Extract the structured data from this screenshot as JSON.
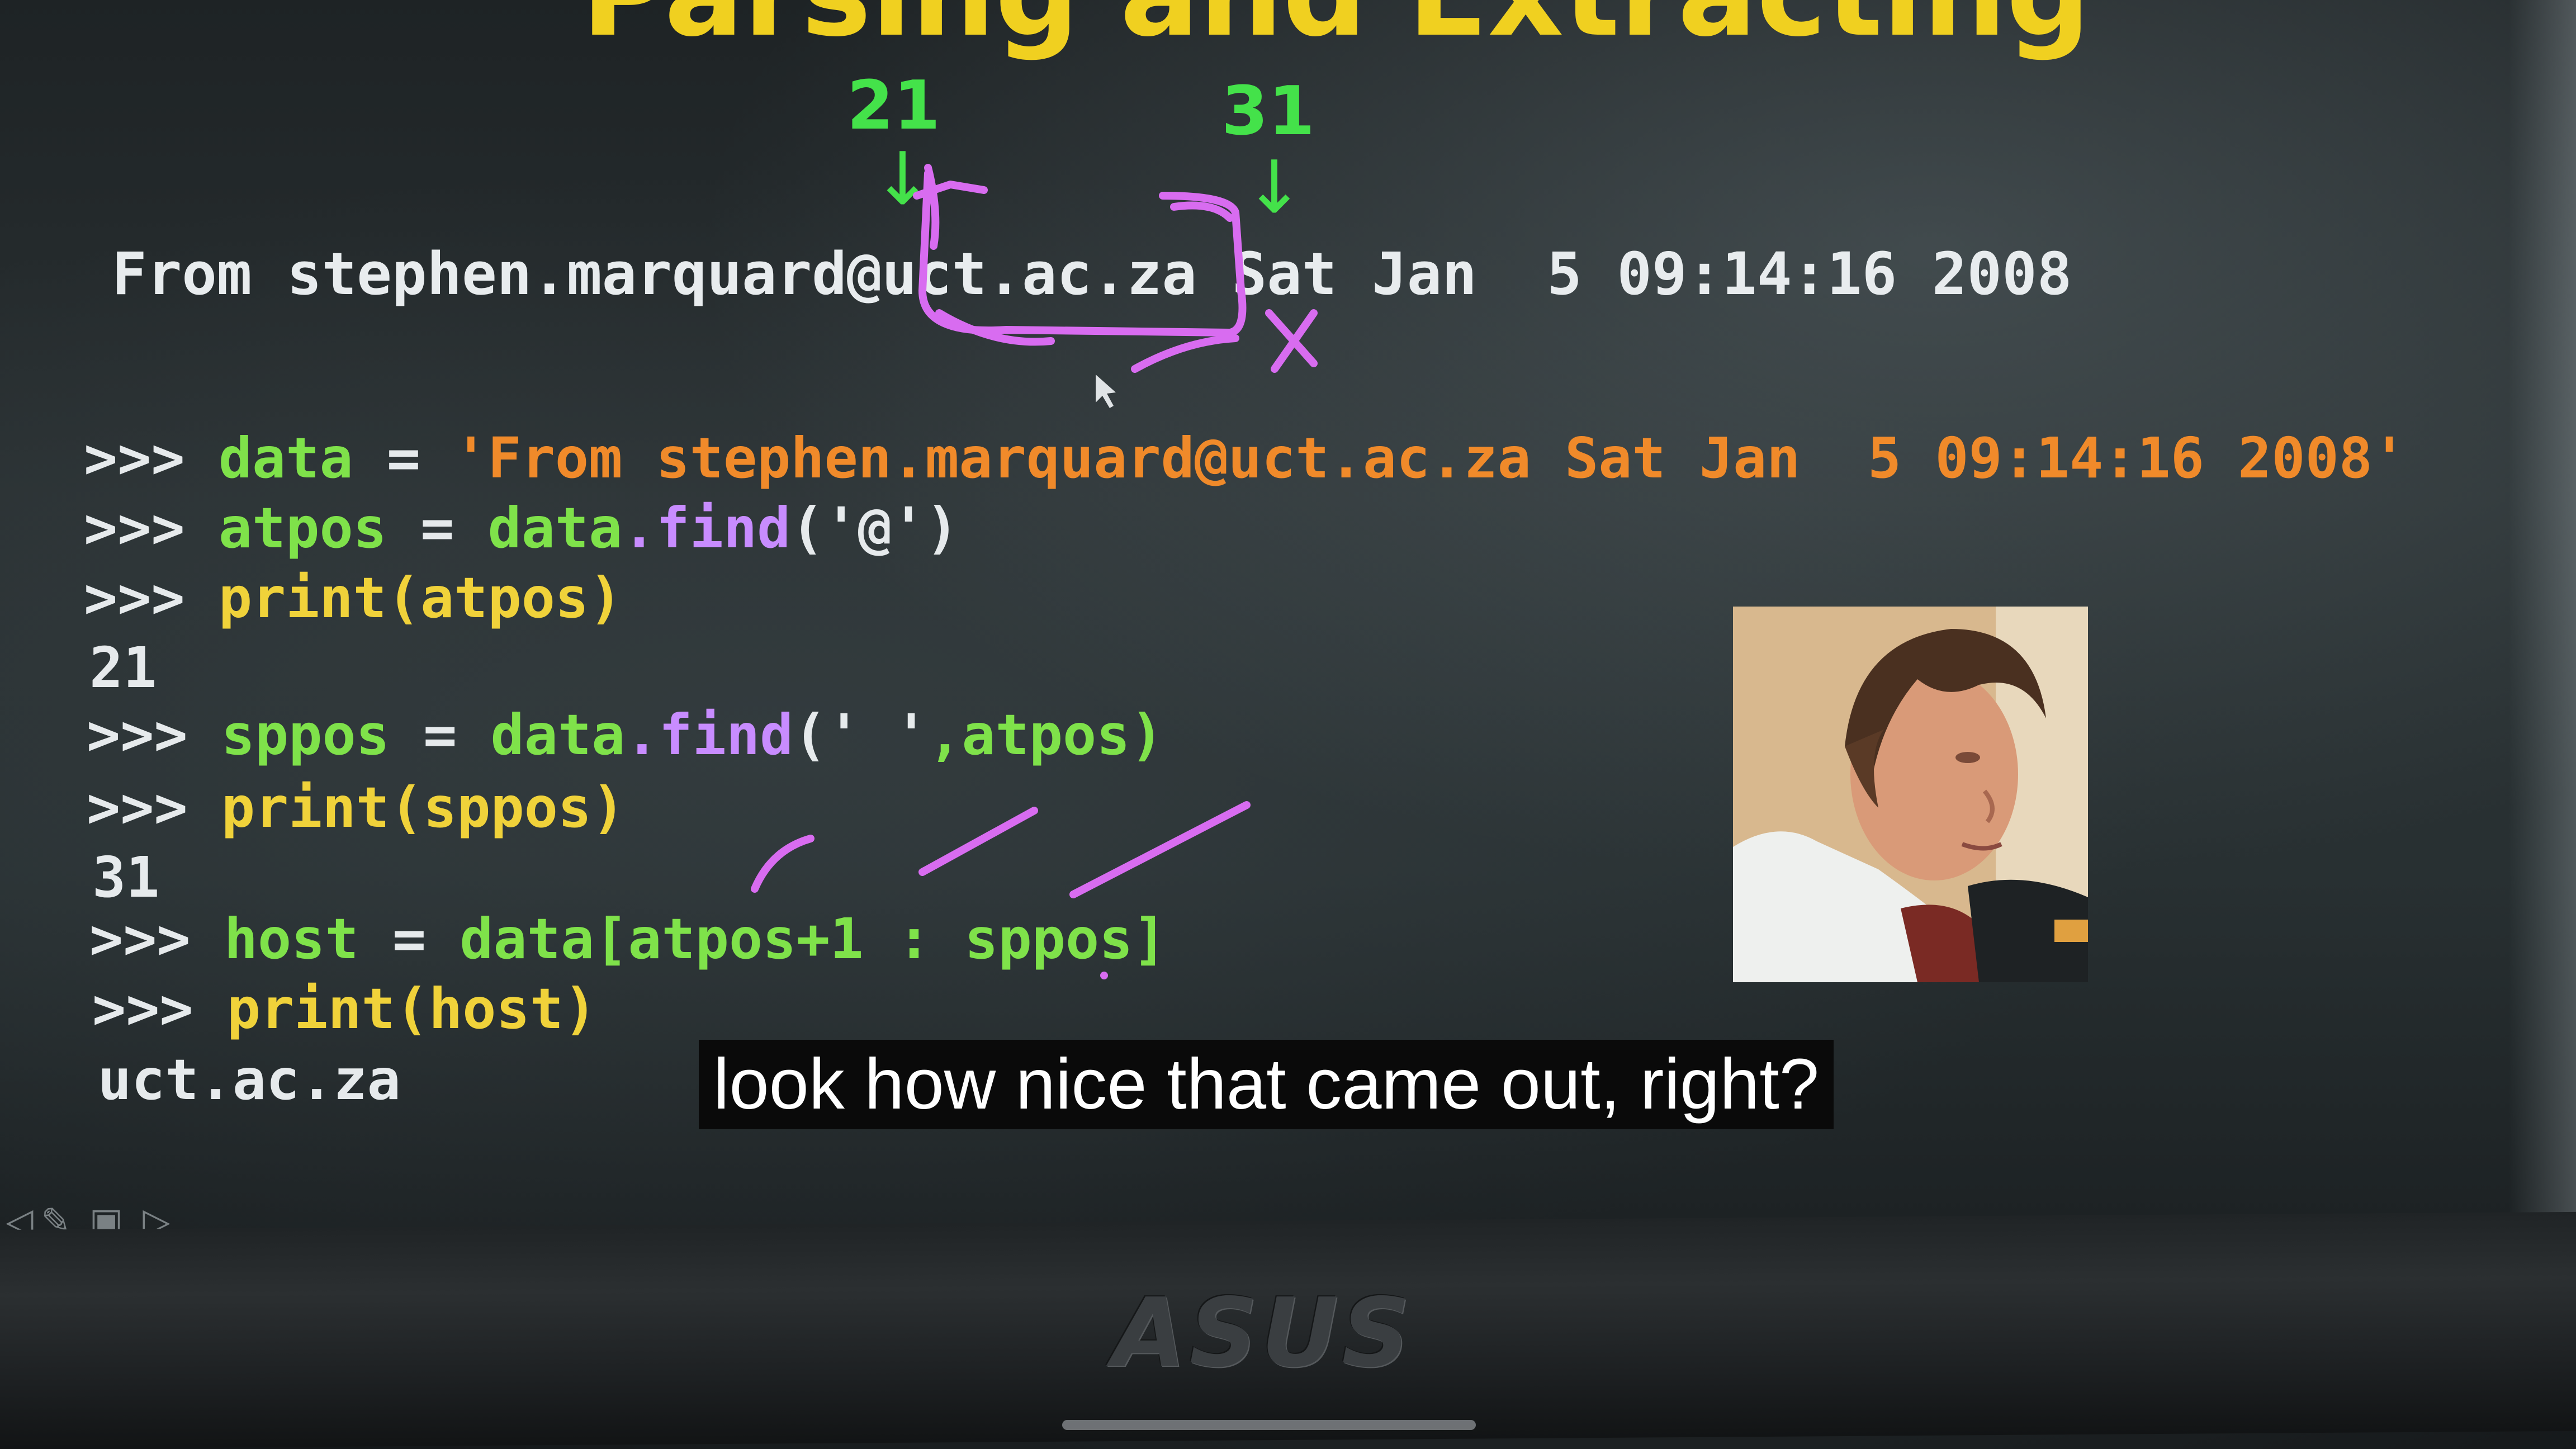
{
  "slide": {
    "title_partial": "Parsing and Extracting",
    "markers": {
      "at_index": "21",
      "space_index": "31"
    },
    "header_line": "From stephen.marquard@uct.ac.za Sat Jan  5 09:14:16 2008",
    "code": {
      "prompt": ">>>",
      "line1": {
        "var": "data",
        "eq": " = ",
        "string": "'From stephen.marquard@uct.ac.za Sat Jan  5 09:14:16 2008'"
      },
      "line2": {
        "var": "atpos",
        "eq": " = ",
        "obj": "data",
        "dot": ".",
        "method": "find",
        "args": "('@')"
      },
      "line3": "print(atpos)",
      "out1": "21",
      "line4": {
        "var": "sppos",
        "eq": " = ",
        "obj": "data",
        "dot": ".",
        "method": "find",
        "args_str": "(' '",
        "args_rest": ",atpos)"
      },
      "line5": "print(sppos)",
      "out2": "31",
      "line6": {
        "var": "host",
        "eq": " = ",
        "expr": "data[atpos+1 : sppos]"
      },
      "line7": "print(host)",
      "out3": "uct.ac.za"
    }
  },
  "caption": "look how nice that came out, right?",
  "device": {
    "brand": "ASUS"
  },
  "toolbar": {
    "icons": [
      "back-icon",
      "pen-icon",
      "slides-icon",
      "forward-icon"
    ]
  },
  "colors": {
    "title": "#f0d020",
    "marker_green": "#44e24a",
    "code_green": "#7fe24a",
    "string_orange": "#f08a2a",
    "keyword_yellow": "#f0d23a",
    "method_violet": "#c88cff",
    "ink_magenta": "#d86cf0"
  }
}
